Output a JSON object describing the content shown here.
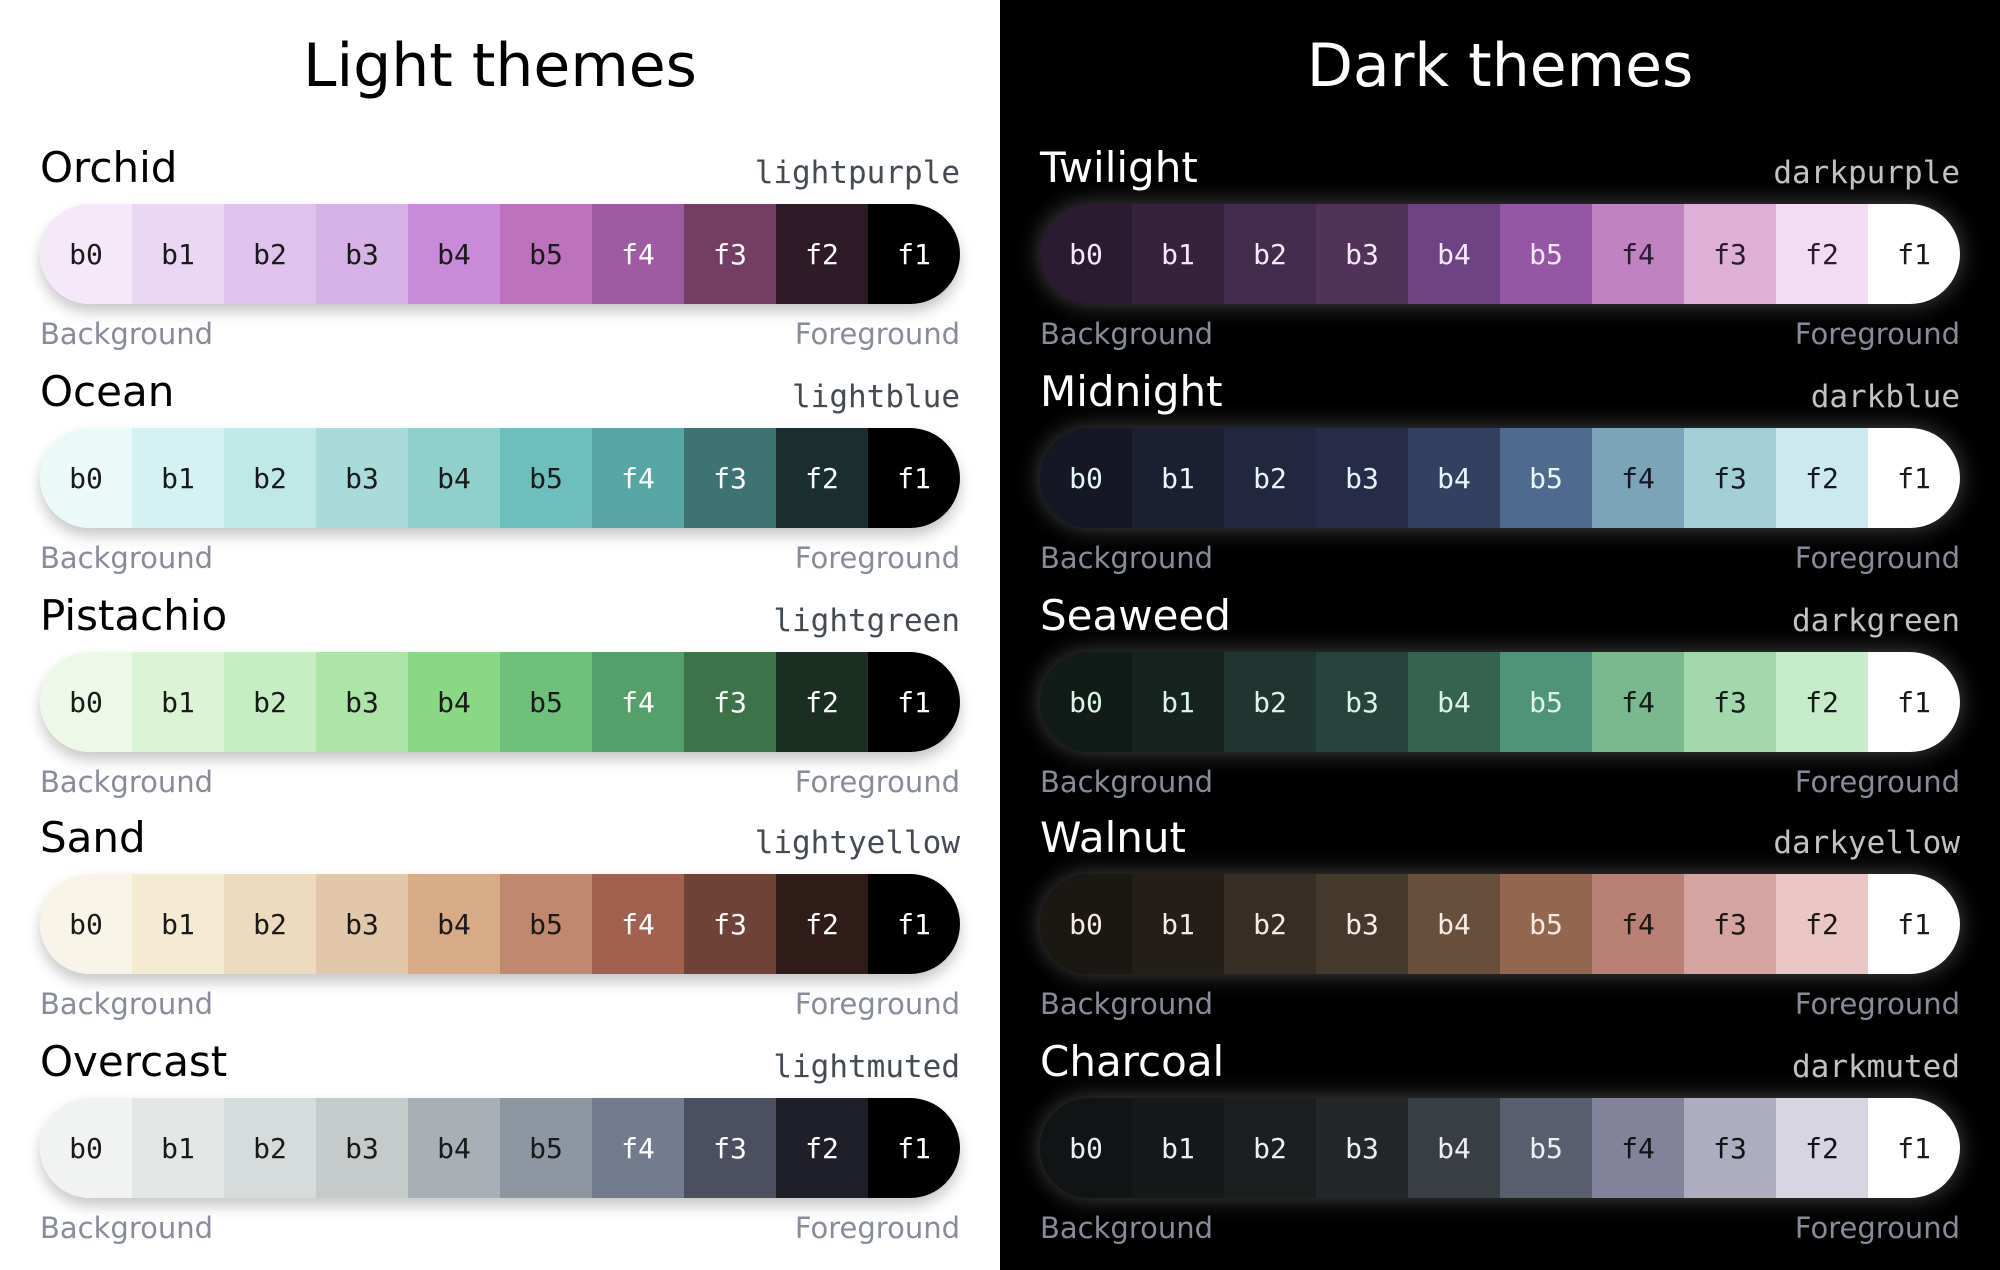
{
  "panels": [
    {
      "key": "light",
      "title": "Light themes",
      "themes": [
        {
          "name": "Orchid",
          "code": "lightpurple",
          "background_label": "Background",
          "foreground_label": "Foreground",
          "swatches": [
            {
              "label": "b0",
              "bg": "#f5e9f9",
              "fg": "#1a1a1a"
            },
            {
              "label": "b1",
              "bg": "#ead7f3",
              "fg": "#1a1a1a"
            },
            {
              "label": "b2",
              "bg": "#dfc2ee",
              "fg": "#1a1a1a"
            },
            {
              "label": "b3",
              "bg": "#d6b2e6",
              "fg": "#1a1a1a"
            },
            {
              "label": "b4",
              "bg": "#c98ad9",
              "fg": "#1a1a1a"
            },
            {
              "label": "b5",
              "bg": "#bd72bd",
              "fg": "#1a1a1a"
            },
            {
              "label": "f4",
              "bg": "#9e5aa2",
              "fg": "#ffffff"
            },
            {
              "label": "f3",
              "bg": "#733d64",
              "fg": "#ffffff"
            },
            {
              "label": "f2",
              "bg": "#2f1a28",
              "fg": "#ffffff"
            },
            {
              "label": "f1",
              "bg": "#000000",
              "fg": "#ffffff"
            }
          ]
        },
        {
          "name": "Ocean",
          "code": "lightblue",
          "background_label": "Background",
          "foreground_label": "Foreground",
          "swatches": [
            {
              "label": "b0",
              "bg": "#ebf9f9",
              "fg": "#1a1a1a"
            },
            {
              "label": "b1",
              "bg": "#d3f2f1",
              "fg": "#1a1a1a"
            },
            {
              "label": "b2",
              "bg": "#bfe8e6",
              "fg": "#1a1a1a"
            },
            {
              "label": "b3",
              "bg": "#a8dbda",
              "fg": "#1a1a1a"
            },
            {
              "label": "b4",
              "bg": "#8fd0cc",
              "fg": "#1a1a1a"
            },
            {
              "label": "b5",
              "bg": "#6cbfbd",
              "fg": "#1a1a1a"
            },
            {
              "label": "f4",
              "bg": "#56a6a5",
              "fg": "#ffffff"
            },
            {
              "label": "f3",
              "bg": "#3d7473",
              "fg": "#ffffff"
            },
            {
              "label": "f2",
              "bg": "#1a2e2f",
              "fg": "#ffffff"
            },
            {
              "label": "f1",
              "bg": "#000000",
              "fg": "#ffffff"
            }
          ]
        },
        {
          "name": "Pistachio",
          "code": "lightgreen",
          "background_label": "Background",
          "foreground_label": "Foreground",
          "swatches": [
            {
              "label": "b0",
              "bg": "#eef8e8",
              "fg": "#1a1a1a"
            },
            {
              "label": "b1",
              "bg": "#dcf4d6",
              "fg": "#1a1a1a"
            },
            {
              "label": "b2",
              "bg": "#c6eec2",
              "fg": "#1a1a1a"
            },
            {
              "label": "b3",
              "bg": "#ade4a8",
              "fg": "#1a1a1a"
            },
            {
              "label": "b4",
              "bg": "#8bd884",
              "fg": "#1a1a1a"
            },
            {
              "label": "b5",
              "bg": "#6fc07b",
              "fg": "#1a1a1a"
            },
            {
              "label": "f4",
              "bg": "#54a06a",
              "fg": "#ffffff"
            },
            {
              "label": "f3",
              "bg": "#3d7349",
              "fg": "#ffffff"
            },
            {
              "label": "f2",
              "bg": "#1b2e22",
              "fg": "#ffffff"
            },
            {
              "label": "f1",
              "bg": "#000000",
              "fg": "#ffffff"
            }
          ]
        },
        {
          "name": "Sand",
          "code": "lightyellow",
          "background_label": "Background",
          "foreground_label": "Foreground",
          "swatches": [
            {
              "label": "b0",
              "bg": "#f8f4e8",
              "fg": "#1a1a1a"
            },
            {
              "label": "b1",
              "bg": "#f4ebd2",
              "fg": "#1a1a1a"
            },
            {
              "label": "b2",
              "bg": "#ecdbbe",
              "fg": "#1a1a1a"
            },
            {
              "label": "b3",
              "bg": "#e2c7aa",
              "fg": "#1a1a1a"
            },
            {
              "label": "b4",
              "bg": "#d6ab86",
              "fg": "#1a1a1a"
            },
            {
              "label": "b5",
              "bg": "#c0896f",
              "fg": "#1a1a1a"
            },
            {
              "label": "f4",
              "bg": "#a2614f",
              "fg": "#ffffff"
            },
            {
              "label": "f3",
              "bg": "#6e4237",
              "fg": "#ffffff"
            },
            {
              "label": "f2",
              "bg": "#2f1b18",
              "fg": "#ffffff"
            },
            {
              "label": "f1",
              "bg": "#000000",
              "fg": "#ffffff"
            }
          ]
        },
        {
          "name": "Overcast",
          "code": "lightmuted",
          "background_label": "Background",
          "foreground_label": "Foreground",
          "swatches": [
            {
              "label": "b0",
              "bg": "#f1f2f2",
              "fg": "#1a1a1a"
            },
            {
              "label": "b1",
              "bg": "#e2e6e5",
              "fg": "#1a1a1a"
            },
            {
              "label": "b2",
              "bg": "#d6dcdb",
              "fg": "#1a1a1a"
            },
            {
              "label": "b3",
              "bg": "#c5cacb",
              "fg": "#1a1a1a"
            },
            {
              "label": "b4",
              "bg": "#a9b0b5",
              "fg": "#1a1a1a"
            },
            {
              "label": "b5",
              "bg": "#8d96a1",
              "fg": "#1a1a1a"
            },
            {
              "label": "f4",
              "bg": "#737b8e",
              "fg": "#ffffff"
            },
            {
              "label": "f3",
              "bg": "#4b4f60",
              "fg": "#ffffff"
            },
            {
              "label": "f2",
              "bg": "#1f1f2a",
              "fg": "#ffffff"
            },
            {
              "label": "f1",
              "bg": "#000000",
              "fg": "#ffffff"
            }
          ]
        }
      ]
    },
    {
      "key": "dark",
      "title": "Dark themes",
      "themes": [
        {
          "name": "Twilight",
          "code": "darkpurple",
          "background_label": "Background",
          "foreground_label": "Foreground",
          "swatches": [
            {
              "label": "b0",
              "bg": "#2a1b31",
              "fg": "#f5e9f9"
            },
            {
              "label": "b1",
              "bg": "#35223d",
              "fg": "#f5e9f9"
            },
            {
              "label": "b2",
              "bg": "#422b4c",
              "fg": "#f5e9f9"
            },
            {
              "label": "b3",
              "bg": "#51335a",
              "fg": "#f5e9f9"
            },
            {
              "label": "b4",
              "bg": "#6e4383",
              "fg": "#f5e9f9"
            },
            {
              "label": "b5",
              "bg": "#9656a6",
              "fg": "#f5e9f9"
            },
            {
              "label": "f4",
              "bg": "#c082c0",
              "fg": "#2a1b31"
            },
            {
              "label": "f3",
              "bg": "#deb0d8",
              "fg": "#2a1b31"
            },
            {
              "label": "f2",
              "bg": "#f3dcf1",
              "fg": "#2a1b31"
            },
            {
              "label": "f1",
              "bg": "#ffffff",
              "fg": "#1a1a1a"
            }
          ]
        },
        {
          "name": "Midnight",
          "code": "darkblue",
          "background_label": "Background",
          "foreground_label": "Foreground",
          "swatches": [
            {
              "label": "b0",
              "bg": "#151725",
              "fg": "#e6f6f8"
            },
            {
              "label": "b1",
              "bg": "#1c1e31",
              "fg": "#e6f6f8"
            },
            {
              "label": "b2",
              "bg": "#22263e",
              "fg": "#e6f6f8"
            },
            {
              "label": "b3",
              "bg": "#282b48",
              "fg": "#e6f6f8"
            },
            {
              "label": "b4",
              "bg": "#33405f",
              "fg": "#e6f6f8"
            },
            {
              "label": "b5",
              "bg": "#4e6a8f",
              "fg": "#e6f6f8"
            },
            {
              "label": "f4",
              "bg": "#7ba4b8",
              "fg": "#151725"
            },
            {
              "label": "f3",
              "bg": "#a3cfd7",
              "fg": "#151725"
            },
            {
              "label": "f2",
              "bg": "#cbe9ee",
              "fg": "#151725"
            },
            {
              "label": "f1",
              "bg": "#ffffff",
              "fg": "#1a1a1a"
            }
          ]
        },
        {
          "name": "Seaweed",
          "code": "darkgreen",
          "background_label": "Background",
          "foreground_label": "Foreground",
          "swatches": [
            {
              "label": "b0",
              "bg": "#111b18",
              "fg": "#dcf4e4"
            },
            {
              "label": "b1",
              "bg": "#17231f",
              "fg": "#dcf4e4"
            },
            {
              "label": "b2",
              "bg": "#213530",
              "fg": "#dcf4e4"
            },
            {
              "label": "b3",
              "bg": "#27433b",
              "fg": "#dcf4e4"
            },
            {
              "label": "b4",
              "bg": "#366252",
              "fg": "#dcf4e4"
            },
            {
              "label": "b5",
              "bg": "#4f9378",
              "fg": "#dcf4e4"
            },
            {
              "label": "f4",
              "bg": "#7ab98d",
              "fg": "#111b18"
            },
            {
              "label": "f3",
              "bg": "#a3d8ac",
              "fg": "#111b18"
            },
            {
              "label": "f2",
              "bg": "#c6ecca",
              "fg": "#111b18"
            },
            {
              "label": "f1",
              "bg": "#ffffff",
              "fg": "#1a1a1a"
            }
          ]
        },
        {
          "name": "Walnut",
          "code": "darkyellow",
          "background_label": "Background",
          "foreground_label": "Foreground",
          "swatches": [
            {
              "label": "b0",
              "bg": "#1b1713",
              "fg": "#f6ebe4"
            },
            {
              "label": "b1",
              "bg": "#241e19",
              "fg": "#f6ebe4"
            },
            {
              "label": "b2",
              "bg": "#362d24",
              "fg": "#f6ebe4"
            },
            {
              "label": "b3",
              "bg": "#44392a",
              "fg": "#f6ebe4"
            },
            {
              "label": "b4",
              "bg": "#684f3c",
              "fg": "#f6ebe4"
            },
            {
              "label": "b5",
              "bg": "#92664f",
              "fg": "#f6ebe4"
            },
            {
              "label": "f4",
              "bg": "#b98176",
              "fg": "#1b1713"
            },
            {
              "label": "f3",
              "bg": "#d6a4a0",
              "fg": "#1b1713"
            },
            {
              "label": "f2",
              "bg": "#eac6c5",
              "fg": "#1b1713"
            },
            {
              "label": "f1",
              "bg": "#ffffff",
              "fg": "#1a1a1a"
            }
          ]
        },
        {
          "name": "Charcoal",
          "code": "darkmuted",
          "background_label": "Background",
          "foreground_label": "Foreground",
          "swatches": [
            {
              "label": "b0",
              "bg": "#111415",
              "fg": "#eceef0"
            },
            {
              "label": "b1",
              "bg": "#16191a",
              "fg": "#eceef0"
            },
            {
              "label": "b2",
              "bg": "#1c1f20",
              "fg": "#eceef0"
            },
            {
              "label": "b3",
              "bg": "#23272a",
              "fg": "#eceef0"
            },
            {
              "label": "b4",
              "bg": "#393d44",
              "fg": "#eceef0"
            },
            {
              "label": "b5",
              "bg": "#5a5f6f",
              "fg": "#eceef0"
            },
            {
              "label": "f4",
              "bg": "#82839b",
              "fg": "#111415"
            },
            {
              "label": "f3",
              "bg": "#adadbf",
              "fg": "#111415"
            },
            {
              "label": "f2",
              "bg": "#d6d5e1",
              "fg": "#111415"
            },
            {
              "label": "f1",
              "bg": "#ffffff",
              "fg": "#1a1a1a"
            }
          ]
        }
      ]
    }
  ]
}
